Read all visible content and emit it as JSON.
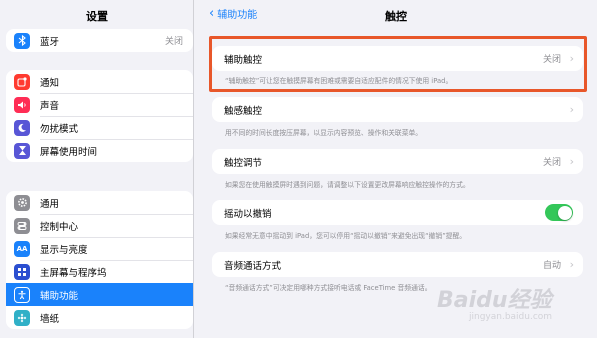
{
  "sidebar": {
    "title": "设置",
    "group1": [
      {
        "label": "蓝牙",
        "value": "关闭",
        "icon": "bluetooth-icon",
        "color": "#1a82fb"
      }
    ],
    "group2": [
      {
        "label": "通知",
        "icon": "notification-icon",
        "color": "#ff3b30"
      },
      {
        "label": "声音",
        "icon": "sound-icon",
        "color": "#ff2d55"
      },
      {
        "label": "勿扰模式",
        "icon": "moon-icon",
        "color": "#5856d6"
      },
      {
        "label": "屏幕使用时间",
        "icon": "hourglass-icon",
        "color": "#5856d6"
      }
    ],
    "group3": [
      {
        "label": "通用",
        "icon": "gear-icon",
        "color": "#8e8e93"
      },
      {
        "label": "控制中心",
        "icon": "control-center-icon",
        "color": "#8e8e93"
      },
      {
        "label": "显示与亮度",
        "icon": "display-icon",
        "color": "#1a82fb"
      },
      {
        "label": "主屏幕与程序坞",
        "icon": "home-screen-icon",
        "color": "#2c4fd0"
      },
      {
        "label": "辅助功能",
        "icon": "accessibility-icon",
        "color": "#1a82fb",
        "selected": true
      },
      {
        "label": "墙纸",
        "icon": "wallpaper-icon",
        "color": "#30b0c7"
      }
    ]
  },
  "nav": {
    "back_label": "辅助功能",
    "title": "触控"
  },
  "settings": {
    "assistive_touch": {
      "label": "辅助触控",
      "value": "关闭",
      "footer": "“辅助触控”可让您在触摸屏幕有困难或需要自适应配件的情况下使用 iPad。"
    },
    "haptic_touch": {
      "label": "触感触控",
      "footer": "用不同的时间长度按压屏幕，以显示内容预览、操作和关联菜单。"
    },
    "touch_accommodations": {
      "label": "触控调节",
      "value": "关闭",
      "footer": "如果您在使用触摸屏时遇到问题，请调整以下设置更改屏幕响应触控操作的方式。"
    },
    "shake_to_undo": {
      "label": "摇动以撤销",
      "enabled": true,
      "footer": "如果经常无意中摇动到 iPad，您可以停用“摇动以撤销”来避免出现“撤销”提醒。"
    },
    "call_audio_routing": {
      "label": "音频通话方式",
      "value": "自动",
      "footer": "“音频通话方式”可决定用哪种方式接听电话或 FaceTime 音频通话。"
    }
  },
  "watermark": {
    "brand": "Baidu经验",
    "sub": "jingyan.baidu.com"
  },
  "colors": {
    "accent": "#1a82fb",
    "highlight": "#e8572a",
    "toggle_on": "#34c759"
  }
}
